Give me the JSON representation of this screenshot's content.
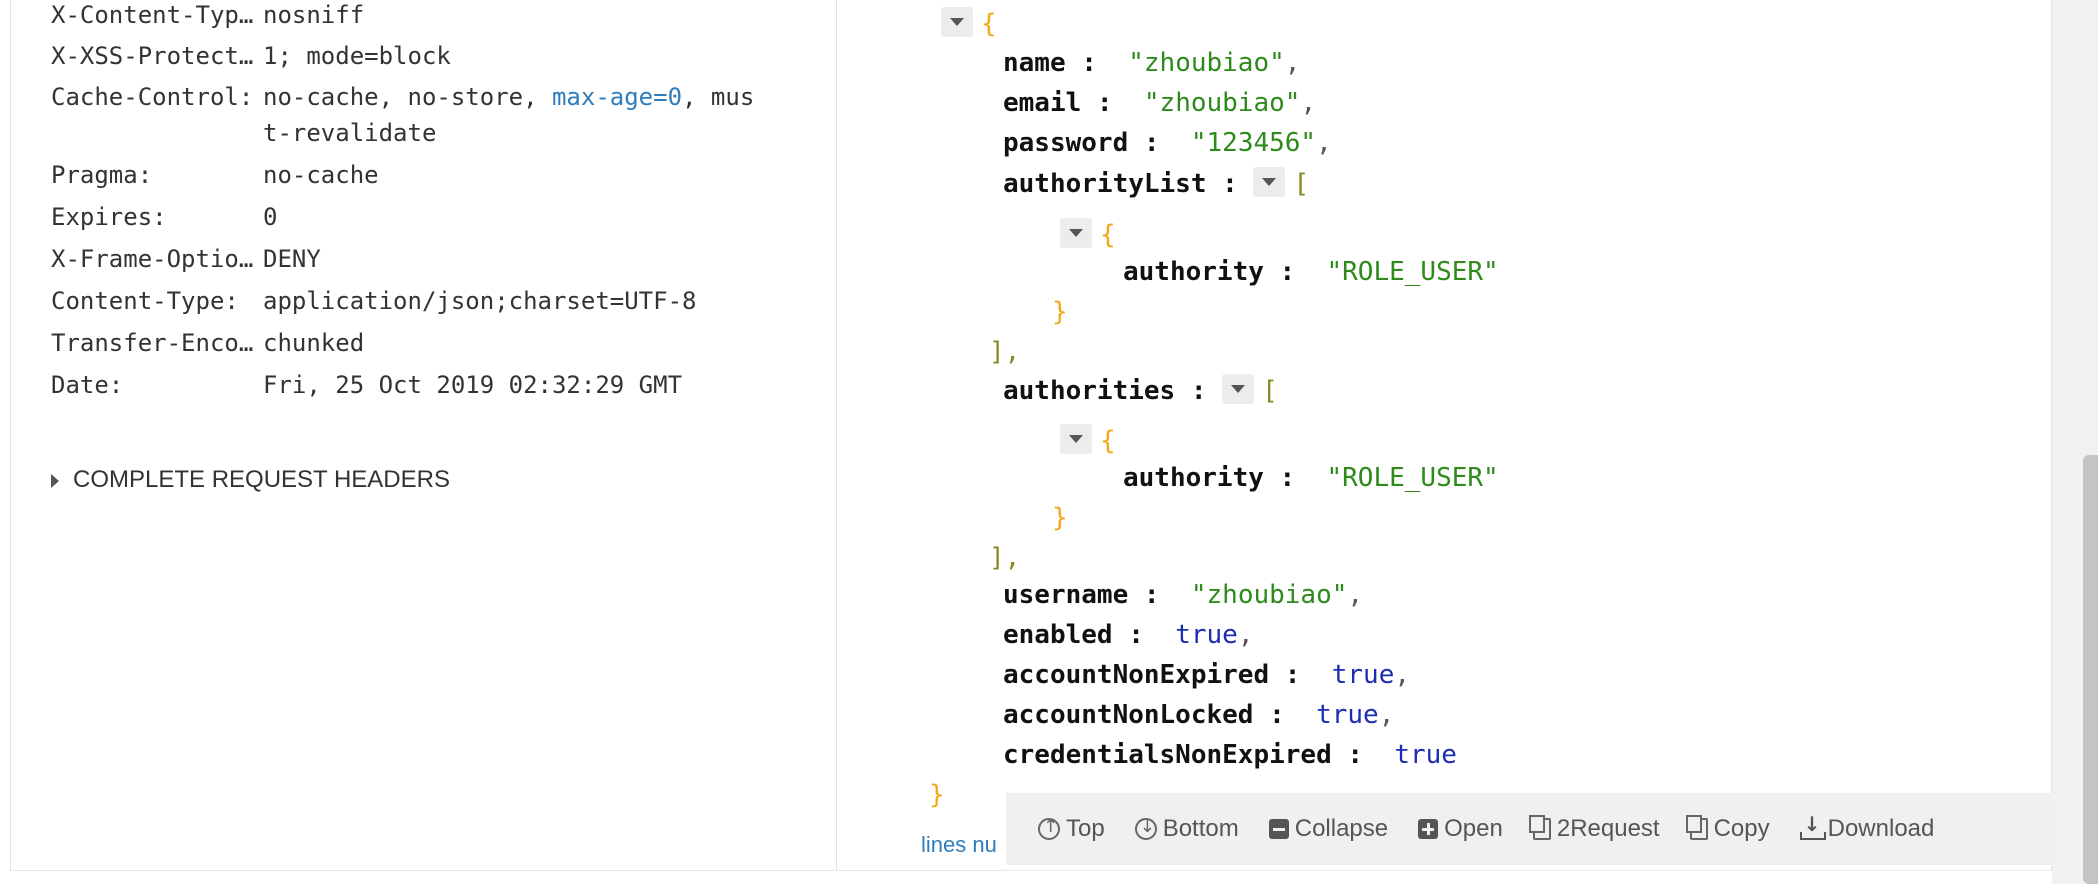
{
  "headers": [
    {
      "name": "X-Content-Typ…",
      "value": "nosniff"
    },
    {
      "name": "X-XSS-Protect…",
      "value": "1; mode=block"
    },
    {
      "name": "Cache-Control:",
      "value_before": "no-cache, no-store, ",
      "value_link": "max-age=0",
      "value_after": ", mus",
      "value_line2": "t-revalidate"
    },
    {
      "name": "Pragma:",
      "value": "no-cache"
    },
    {
      "name": "Expires:",
      "value": "0"
    },
    {
      "name": "X-Frame-Optio…",
      "value": "DENY"
    },
    {
      "name": "Content-Type:",
      "value": "application/json;charset=UTF-8"
    },
    {
      "name": "Transfer-Enco…",
      "value": "chunked"
    },
    {
      "name": "Date:",
      "value": "Fri, 25 Oct 2019 02:32:29 GMT"
    }
  ],
  "complete_request_headers": "COMPLETE REQUEST HEADERS",
  "json": {
    "open_brace": "{",
    "close_brace": "}",
    "open_bracket": "[",
    "close_bracket": "],",
    "name_key": "name :",
    "name_val": "\"zhoubiao\"",
    "email_key": "email :",
    "email_val": "\"zhoubiao\"",
    "password_key": "password :",
    "password_val": "\"123456\"",
    "authorityList_key": "authorityList :",
    "authority_key": "authority :",
    "authority_val": "\"ROLE_USER\"",
    "authorities_key": "authorities :",
    "username_key": "username :",
    "username_val": "\"zhoubiao\"",
    "enabled_key": "enabled :",
    "accountNonExpired_key": "accountNonExpired :",
    "accountNonLocked_key": "accountNonLocked :",
    "credentialsNonExpired_key": "credentialsNonExpired :",
    "true_val": "true",
    "comma": ","
  },
  "lines_num_label": "lines nu",
  "toolbar": {
    "top": "Top",
    "bottom": "Bottom",
    "collapse": "Collapse",
    "open": "Open",
    "request": "2Request",
    "copy": "Copy",
    "download": "Download"
  }
}
